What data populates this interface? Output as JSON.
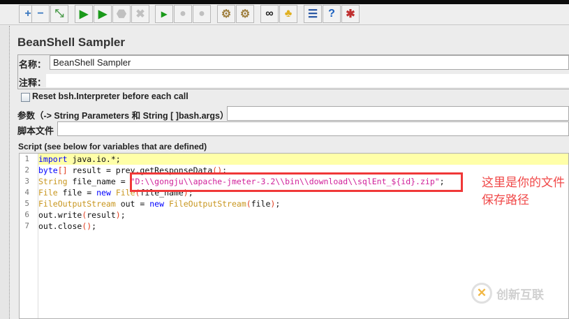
{
  "toolbar": {
    "buttons": [
      {
        "name": "add-icon",
        "glyph": "+",
        "color": "#3a78c0"
      },
      {
        "name": "remove-icon",
        "glyph": "−",
        "color": "#3a78c0"
      },
      {
        "name": "toggle-icon",
        "glyph": "⤡",
        "color": "#4a9a4a"
      },
      {
        "name": "start-icon",
        "glyph": "▶",
        "color": "#1a9a1a"
      },
      {
        "name": "start-no-pause-icon",
        "glyph": "▶",
        "color": "#1a9a1a"
      },
      {
        "name": "stop-icon",
        "glyph": "⬣",
        "color": "#c0c0c0"
      },
      {
        "name": "shutdown-icon",
        "glyph": "✖",
        "color": "#c0c0c0"
      },
      {
        "name": "remote-start-icon",
        "glyph": "▸",
        "color": "#1a9a1a"
      },
      {
        "name": "remote-stop-icon",
        "glyph": "●",
        "color": "#c0c0c0"
      },
      {
        "name": "remote-shutdown-icon",
        "glyph": "●",
        "color": "#c0c0c0"
      },
      {
        "name": "clear-icon",
        "glyph": "⚙",
        "color": "#a08040"
      },
      {
        "name": "clear-all-icon",
        "glyph": "⚙",
        "color": "#a08040"
      },
      {
        "name": "search-icon",
        "glyph": "∞",
        "color": "#222"
      },
      {
        "name": "reset-search-icon",
        "glyph": "♣",
        "color": "#e0b020"
      },
      {
        "name": "function-helper-icon",
        "glyph": "☰",
        "color": "#2050a0"
      },
      {
        "name": "help-icon",
        "glyph": "?",
        "color": "#1a60c0"
      },
      {
        "name": "logger-icon",
        "glyph": "✱",
        "color": "#c03030"
      }
    ]
  },
  "sampler": {
    "title": "BeanShell Sampler",
    "name_label": "名称：",
    "name_value": "BeanShell Sampler",
    "comment_label": "注释：",
    "comment_value": "",
    "reset_label": "Reset bsh.Interpreter before each call",
    "params_label": "参数（-> String Parameters 和 String [ ]bash.args）",
    "params_value": "",
    "script_file_label": "脚本文件",
    "script_file_value": "",
    "script_label": "Script (see below for variables that are defined)"
  },
  "code": {
    "colors": {
      "kw": "#0000ff",
      "type": "#c8961e",
      "str": "#d0209a",
      "paren": "#e03c1c",
      "plain": "#111111"
    },
    "lines": [
      [
        [
          "kw",
          "import"
        ],
        [
          "plain",
          " java.io.*;"
        ]
      ],
      [
        [
          "kw",
          "byte"
        ],
        [
          "paren",
          "[]"
        ],
        [
          "plain",
          " result = prev.getResponseData"
        ],
        [
          "paren",
          "()"
        ],
        [
          "plain",
          ";"
        ]
      ],
      [
        [
          "type",
          "String"
        ],
        [
          "plain",
          " file_name = "
        ],
        [
          "str",
          "\"D:\\\\gongju\\\\apache-jmeter-3.2\\\\bin\\\\download\\\\sqlEnt_${id}.zip\""
        ],
        [
          "plain",
          ";"
        ]
      ],
      [
        [
          "type",
          "File"
        ],
        [
          "plain",
          " file = "
        ],
        [
          "kw",
          "new"
        ],
        [
          "plain",
          " "
        ],
        [
          "type",
          "File"
        ],
        [
          "paren",
          "("
        ],
        [
          "plain",
          "file_name"
        ],
        [
          "paren",
          ")"
        ],
        [
          "plain",
          ";"
        ]
      ],
      [
        [
          "type",
          "FileOutputStream"
        ],
        [
          "plain",
          " out = "
        ],
        [
          "kw",
          "new"
        ],
        [
          "plain",
          " "
        ],
        [
          "type",
          "FileOutputStream"
        ],
        [
          "paren",
          "("
        ],
        [
          "plain",
          "file"
        ],
        [
          "paren",
          ")"
        ],
        [
          "plain",
          ";"
        ]
      ],
      [
        [
          "plain",
          "out.write"
        ],
        [
          "paren",
          "("
        ],
        [
          "plain",
          "result"
        ],
        [
          "paren",
          ")"
        ],
        [
          "plain",
          ";"
        ]
      ],
      [
        [
          "plain",
          "out.close"
        ],
        [
          "paren",
          "()"
        ],
        [
          "plain",
          ";"
        ]
      ]
    ]
  },
  "annotation": {
    "line1": "这里是你的文件",
    "line2": "保存路径"
  },
  "watermark": {
    "text": "创新互联"
  }
}
